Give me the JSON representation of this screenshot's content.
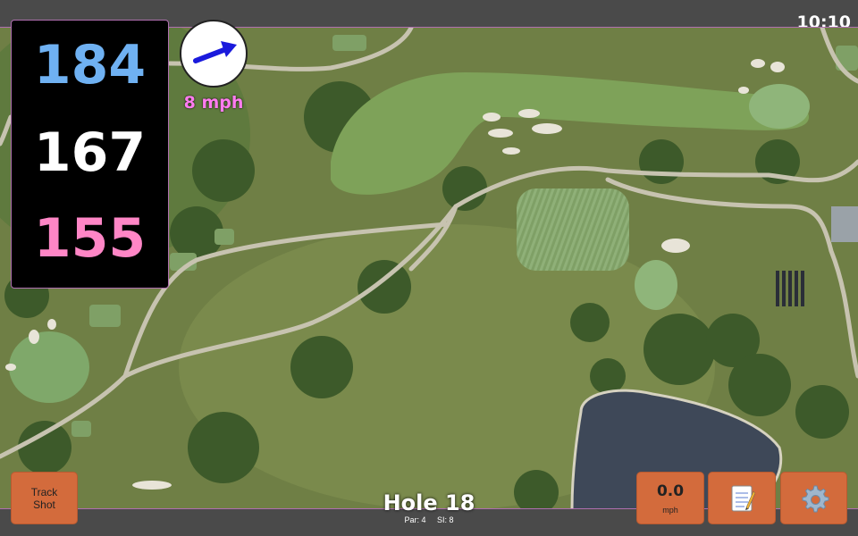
{
  "status": {
    "time": "10:10"
  },
  "yardages": {
    "back": "184",
    "middle": "167",
    "front": "155"
  },
  "colors": {
    "back": "#6fb1f2",
    "middle": "#ffffff",
    "front": "#ff86c6",
    "accent": "#d36b3c",
    "frame": "#b06fb0",
    "wind": "#ff7cf0"
  },
  "wind": {
    "speed": "8 mph",
    "arrow_icon": "wind-direction-arrow-icon"
  },
  "buttons": {
    "track_shot_line1": "Track",
    "track_shot_line2": "Shot",
    "speed_value": "0.0",
    "speed_unit": "mph",
    "notes_icon": "memo-icon",
    "settings_icon": "gear-icon"
  },
  "hole": {
    "title": "Hole 18",
    "par": "Par: 4",
    "si": "SI: 8"
  }
}
